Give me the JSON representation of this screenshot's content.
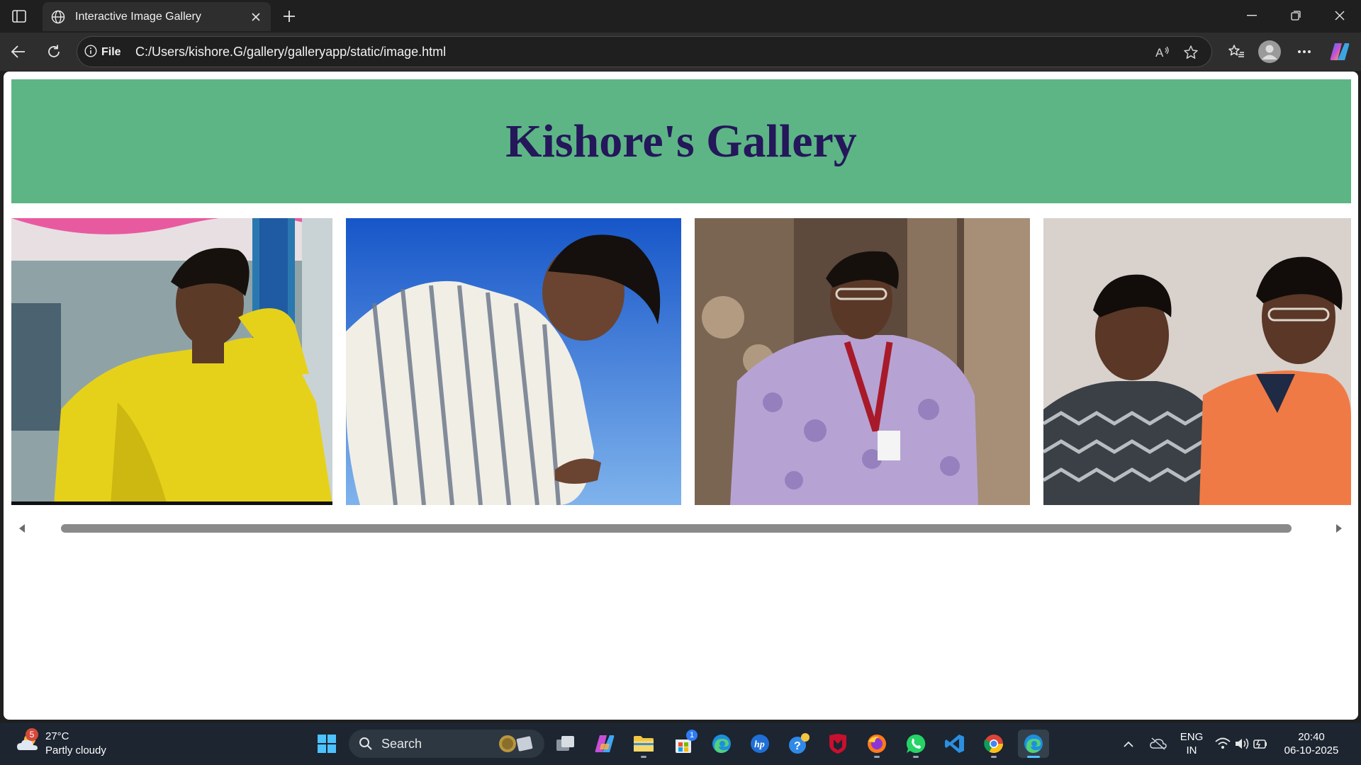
{
  "browser": {
    "tab_title": "Interactive Image Gallery",
    "address_prefix": "File",
    "url": "C:/Users/kishore.G/gallery/galleryapp/static/image.html"
  },
  "page": {
    "heading": "Kishore's Gallery",
    "header_color": "#5db585",
    "heading_color": "#24175a",
    "photos": [
      {
        "description": "person in yellow shirt"
      },
      {
        "description": "person in striped shirt against blue sky"
      },
      {
        "description": "person in purple shirt with lanyard"
      },
      {
        "description": "two friends smiling"
      }
    ]
  },
  "taskbar": {
    "weather_temp": "27°C",
    "weather_desc": "Partly cloudy",
    "weather_badge": "5",
    "search_label": "Search",
    "store_badge": "1",
    "lang_top": "ENG",
    "lang_bottom": "IN",
    "time": "20:40",
    "date": "06-10-2025"
  },
  "colors": {
    "accent": "#4cc2ff",
    "taskbar": "#1c2530"
  }
}
